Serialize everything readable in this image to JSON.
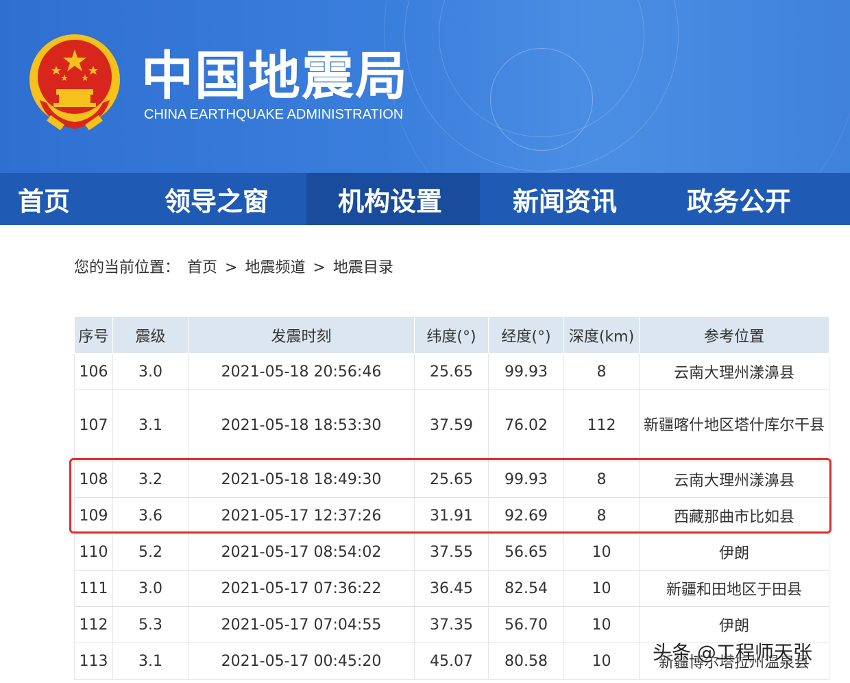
{
  "header": {
    "title_cn": "中国地震局",
    "title_en": "CHINA EARTHQUAKE ADMINISTRATION",
    "emblem_icon": "national-emblem-icon",
    "colors": {
      "banner": "#3a7edc",
      "nav": "#1f5bb5",
      "nav_active": "#194c9c",
      "emblem_red": "#d9261c",
      "emblem_gold": "#f5c21b"
    }
  },
  "nav": {
    "items": [
      {
        "label": "首页"
      },
      {
        "label": "领导之窗"
      },
      {
        "label": "机构设置",
        "active": true
      },
      {
        "label": "新闻资讯"
      },
      {
        "label": "政务公开"
      }
    ]
  },
  "breadcrumb": {
    "prefix": "您的当前位置：",
    "items": [
      "首页",
      "地震频道",
      "地震目录"
    ],
    "separator": ">"
  },
  "table": {
    "columns": [
      "序号",
      "震级",
      "发震时刻",
      "纬度(°)",
      "经度(°)",
      "深度(km)",
      "参考位置"
    ],
    "rows": [
      [
        "106",
        "3.0",
        "2021-05-18 20:56:46",
        "25.65",
        "99.93",
        "8",
        "云南大理州漾濞县"
      ],
      [
        "107",
        "3.1",
        "2021-05-18 18:53:30",
        "37.59",
        "76.02",
        "112",
        "新疆喀什地区塔什库尔干县"
      ],
      [
        "108",
        "3.2",
        "2021-05-18 18:49:30",
        "25.65",
        "99.93",
        "8",
        "云南大理州漾濞县"
      ],
      [
        "109",
        "3.6",
        "2021-05-17 12:37:26",
        "31.91",
        "92.69",
        "8",
        "西藏那曲市比如县"
      ],
      [
        "110",
        "5.2",
        "2021-05-17 08:54:02",
        "37.55",
        "56.65",
        "10",
        "伊朗"
      ],
      [
        "111",
        "3.0",
        "2021-05-17 07:36:22",
        "36.45",
        "82.54",
        "10",
        "新疆和田地区于田县"
      ],
      [
        "112",
        "5.3",
        "2021-05-17 07:04:55",
        "37.35",
        "56.70",
        "10",
        "伊朗"
      ],
      [
        "113",
        "3.1",
        "2021-05-17 00:45:20",
        "45.07",
        "80.58",
        "10",
        "新疆博尔塔拉州温泉县"
      ]
    ],
    "highlight_color": "#e32d2d"
  },
  "watermark": "头条 @工程师天张"
}
